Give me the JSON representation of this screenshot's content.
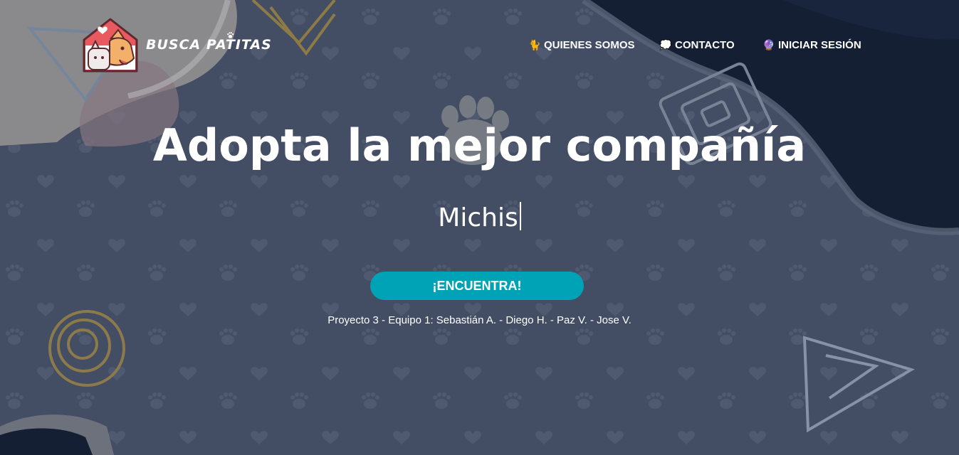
{
  "brand": {
    "name": "BUSCA PATITAS"
  },
  "nav": [
    {
      "icon": "🐈",
      "label": "QUIENES SOMOS"
    },
    {
      "icon": "💭",
      "label": "CONTACTO"
    },
    {
      "icon": "🔮",
      "label": "INICIAR SESIÓN"
    }
  ],
  "hero": {
    "title": "Adopta la mejor compañía",
    "typed": "Michis",
    "button": "¡ENCUENTRA!",
    "credits": "Proyecto 3 - Equipo 1: Sebastián A. - Diego H. - Paz V. - Jose V."
  },
  "colors": {
    "background": "#434d63",
    "dark_blob": "#141f33",
    "cta": "#00a3b5",
    "logo_red": "#e85a5f"
  }
}
